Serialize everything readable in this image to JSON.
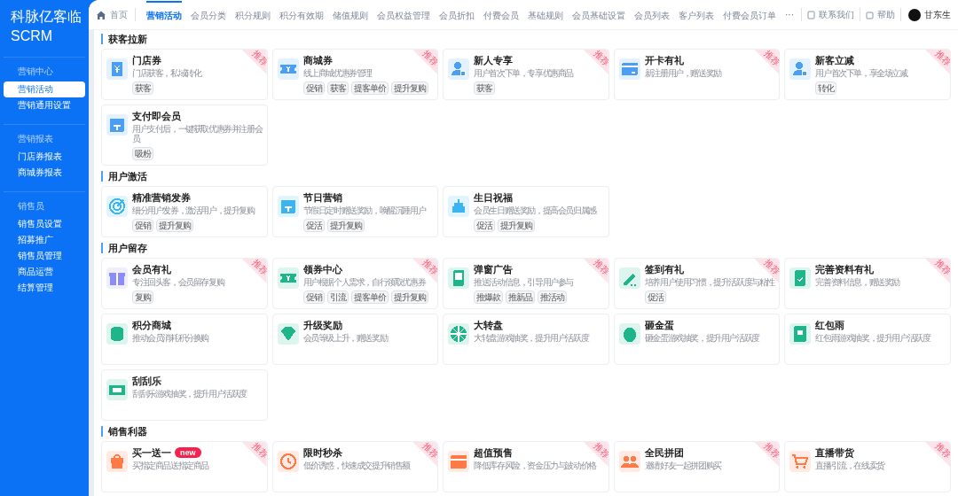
{
  "sidebar": {
    "title": "科脉亿客临",
    "subtitle": "SCRM",
    "groups": [
      {
        "label": "营销中心",
        "items": [
          {
            "label": "营销活动",
            "selected": true
          },
          {
            "label": "营销通用设置",
            "selected": false
          }
        ]
      },
      {
        "label": "营销报表",
        "items": [
          {
            "label": "门店券报表",
            "selected": false
          },
          {
            "label": "商城券报表",
            "selected": false
          }
        ]
      },
      {
        "label": "销售员",
        "items": [
          {
            "label": "销售员设置",
            "selected": false
          },
          {
            "label": "招募推广",
            "selected": false
          },
          {
            "label": "销售员管理",
            "selected": false
          },
          {
            "label": "商品运营",
            "selected": false
          },
          {
            "label": "结算管理",
            "selected": false
          }
        ]
      }
    ]
  },
  "nav": {
    "home": "首页",
    "tabs": [
      {
        "label": "营销活动",
        "selected": true
      },
      {
        "label": "会员分类",
        "selected": false
      },
      {
        "label": "积分规则",
        "selected": false
      },
      {
        "label": "积分有效期",
        "selected": false
      },
      {
        "label": "储值规则",
        "selected": false
      },
      {
        "label": "会员权益管理",
        "selected": false
      },
      {
        "label": "会员折扣",
        "selected": false
      },
      {
        "label": "付费会员",
        "selected": false
      },
      {
        "label": "基础规则",
        "selected": false
      },
      {
        "label": "会员基础设置",
        "selected": false
      },
      {
        "label": "会员列表",
        "selected": false
      },
      {
        "label": "客户列表",
        "selected": false
      },
      {
        "label": "付费会员订单",
        "selected": false
      }
    ],
    "more": "···",
    "contact": "联系我们",
    "help": "帮助",
    "user": "甘东生"
  },
  "sections": [
    {
      "title": "获客拉新",
      "cards": [
        {
          "title": "门店券",
          "desc": "门店获客，私域转化",
          "tags": [
            "获客"
          ],
          "ribbon": "推荐",
          "color": "#4a9ff5"
        },
        {
          "title": "商城券",
          "desc": "线上商城优惠券管理",
          "tags": [
            "促销",
            "获客",
            "提客单价",
            "提升复购"
          ],
          "ribbon": "推荐",
          "color": "#4a9ff5"
        },
        {
          "title": "新人专享",
          "desc": "用户首次下单，专享优惠商品",
          "tags": [
            "获客"
          ],
          "ribbon": "推荐",
          "color": "#4a9ff5"
        },
        {
          "title": "开卡有礼",
          "desc": "新注册用户，赠送奖励",
          "ribbon": "推荐",
          "color": "#4a9ff5"
        },
        {
          "title": "新客立减",
          "desc": "用户首次下单，享全场立减",
          "tags": [
            "转化"
          ],
          "ribbon": "推荐",
          "color": "#4a9ff5"
        },
        {
          "title": "支付即会员",
          "desc": "用户支付后，一键获取优惠券并注册会员",
          "tags": [
            "吸粉"
          ],
          "color": "#4a9ff5"
        }
      ]
    },
    {
      "title": "用户激活",
      "cards": [
        {
          "title": "精准营销发券",
          "desc": "细分用户发券，激活用户，提升复购",
          "tags": [
            "促销",
            "提升复购"
          ],
          "color": "#3db4f2"
        },
        {
          "title": "节日营销",
          "desc": "节假日定时赠送奖励，唤醒沉睡用户",
          "tags": [
            "促活",
            "提升复购"
          ],
          "color": "#3db4f2"
        },
        {
          "title": "生日祝福",
          "desc": "会员生日赠送奖励，提高会员归属感",
          "tags": [
            "促活",
            "提升复购"
          ],
          "color": "#3db4f2"
        }
      ]
    },
    {
      "title": "用户留存",
      "cards": [
        {
          "title": "会员有礼",
          "desc": "专注回头客，会员留存复购",
          "tags": [
            "复购"
          ],
          "ribbon": "推荐",
          "color": "#8c8cf7"
        },
        {
          "title": "领券中心",
          "desc": "用户根据个人需求，自行领取优惠券",
          "tags": [
            "促销",
            "引流",
            "提客单价",
            "提升复购"
          ],
          "ribbon": "推荐",
          "color": "#1fb58a"
        },
        {
          "title": "弹窗广告",
          "desc": "推送活动信息，引导用户参与",
          "tags": [
            "推爆款",
            "推新品",
            "推活动"
          ],
          "ribbon": "推荐",
          "color": "#1fb58a"
        },
        {
          "title": "签到有礼",
          "desc": "培养用户使用习惯，提升活跃度与粘性",
          "tags": [
            "促活"
          ],
          "ribbon": "推荐",
          "color": "#1fb58a"
        },
        {
          "title": "完善资料有礼",
          "desc": "完善资料信息，赠送奖励",
          "ribbon": "推荐",
          "color": "#1fb58a"
        },
        {
          "title": "积分商城",
          "desc": "推动会员消耗积分换购",
          "color": "#1fb58a"
        },
        {
          "title": "升级奖励",
          "desc": "会员等级上升，赠送奖励",
          "color": "#1fb58a"
        },
        {
          "title": "大转盘",
          "desc": "大转盘游戏抽奖，提升用户活跃度",
          "color": "#1fb58a"
        },
        {
          "title": "砸金蛋",
          "desc": "砸金蛋游戏抽奖，提升用户活跃度",
          "color": "#1fb58a"
        },
        {
          "title": "红包雨",
          "desc": "红包雨游戏抽奖，提升用户活跃度",
          "color": "#1fb58a"
        },
        {
          "title": "刮刮乐",
          "desc": "刮刮乐游戏抽奖，提升用户活跃度",
          "color": "#1fb58a"
        }
      ]
    },
    {
      "title": "销售利器",
      "cards": [
        {
          "title": "买一送一",
          "badge": "new",
          "desc": "买指定商品送指定商品",
          "ribbon": "推荐",
          "color": "#ff7a45"
        },
        {
          "title": "限时秒杀",
          "desc": "低价诱惑，快速成交提升销售额",
          "ribbon": "推荐",
          "color": "#ff7a45"
        },
        {
          "title": "超值预售",
          "desc": "降低库存风险，资金压力与波动价格",
          "ribbon": "推荐",
          "color": "#ff7a45"
        },
        {
          "title": "全民拼团",
          "desc": "邀请好友一起拼团购买",
          "ribbon": "推荐",
          "color": "#ff7a45"
        },
        {
          "title": "直播带货",
          "desc": "直播引流，在线卖货",
          "ribbon": "推荐",
          "color": "#ff7a45"
        }
      ]
    }
  ]
}
